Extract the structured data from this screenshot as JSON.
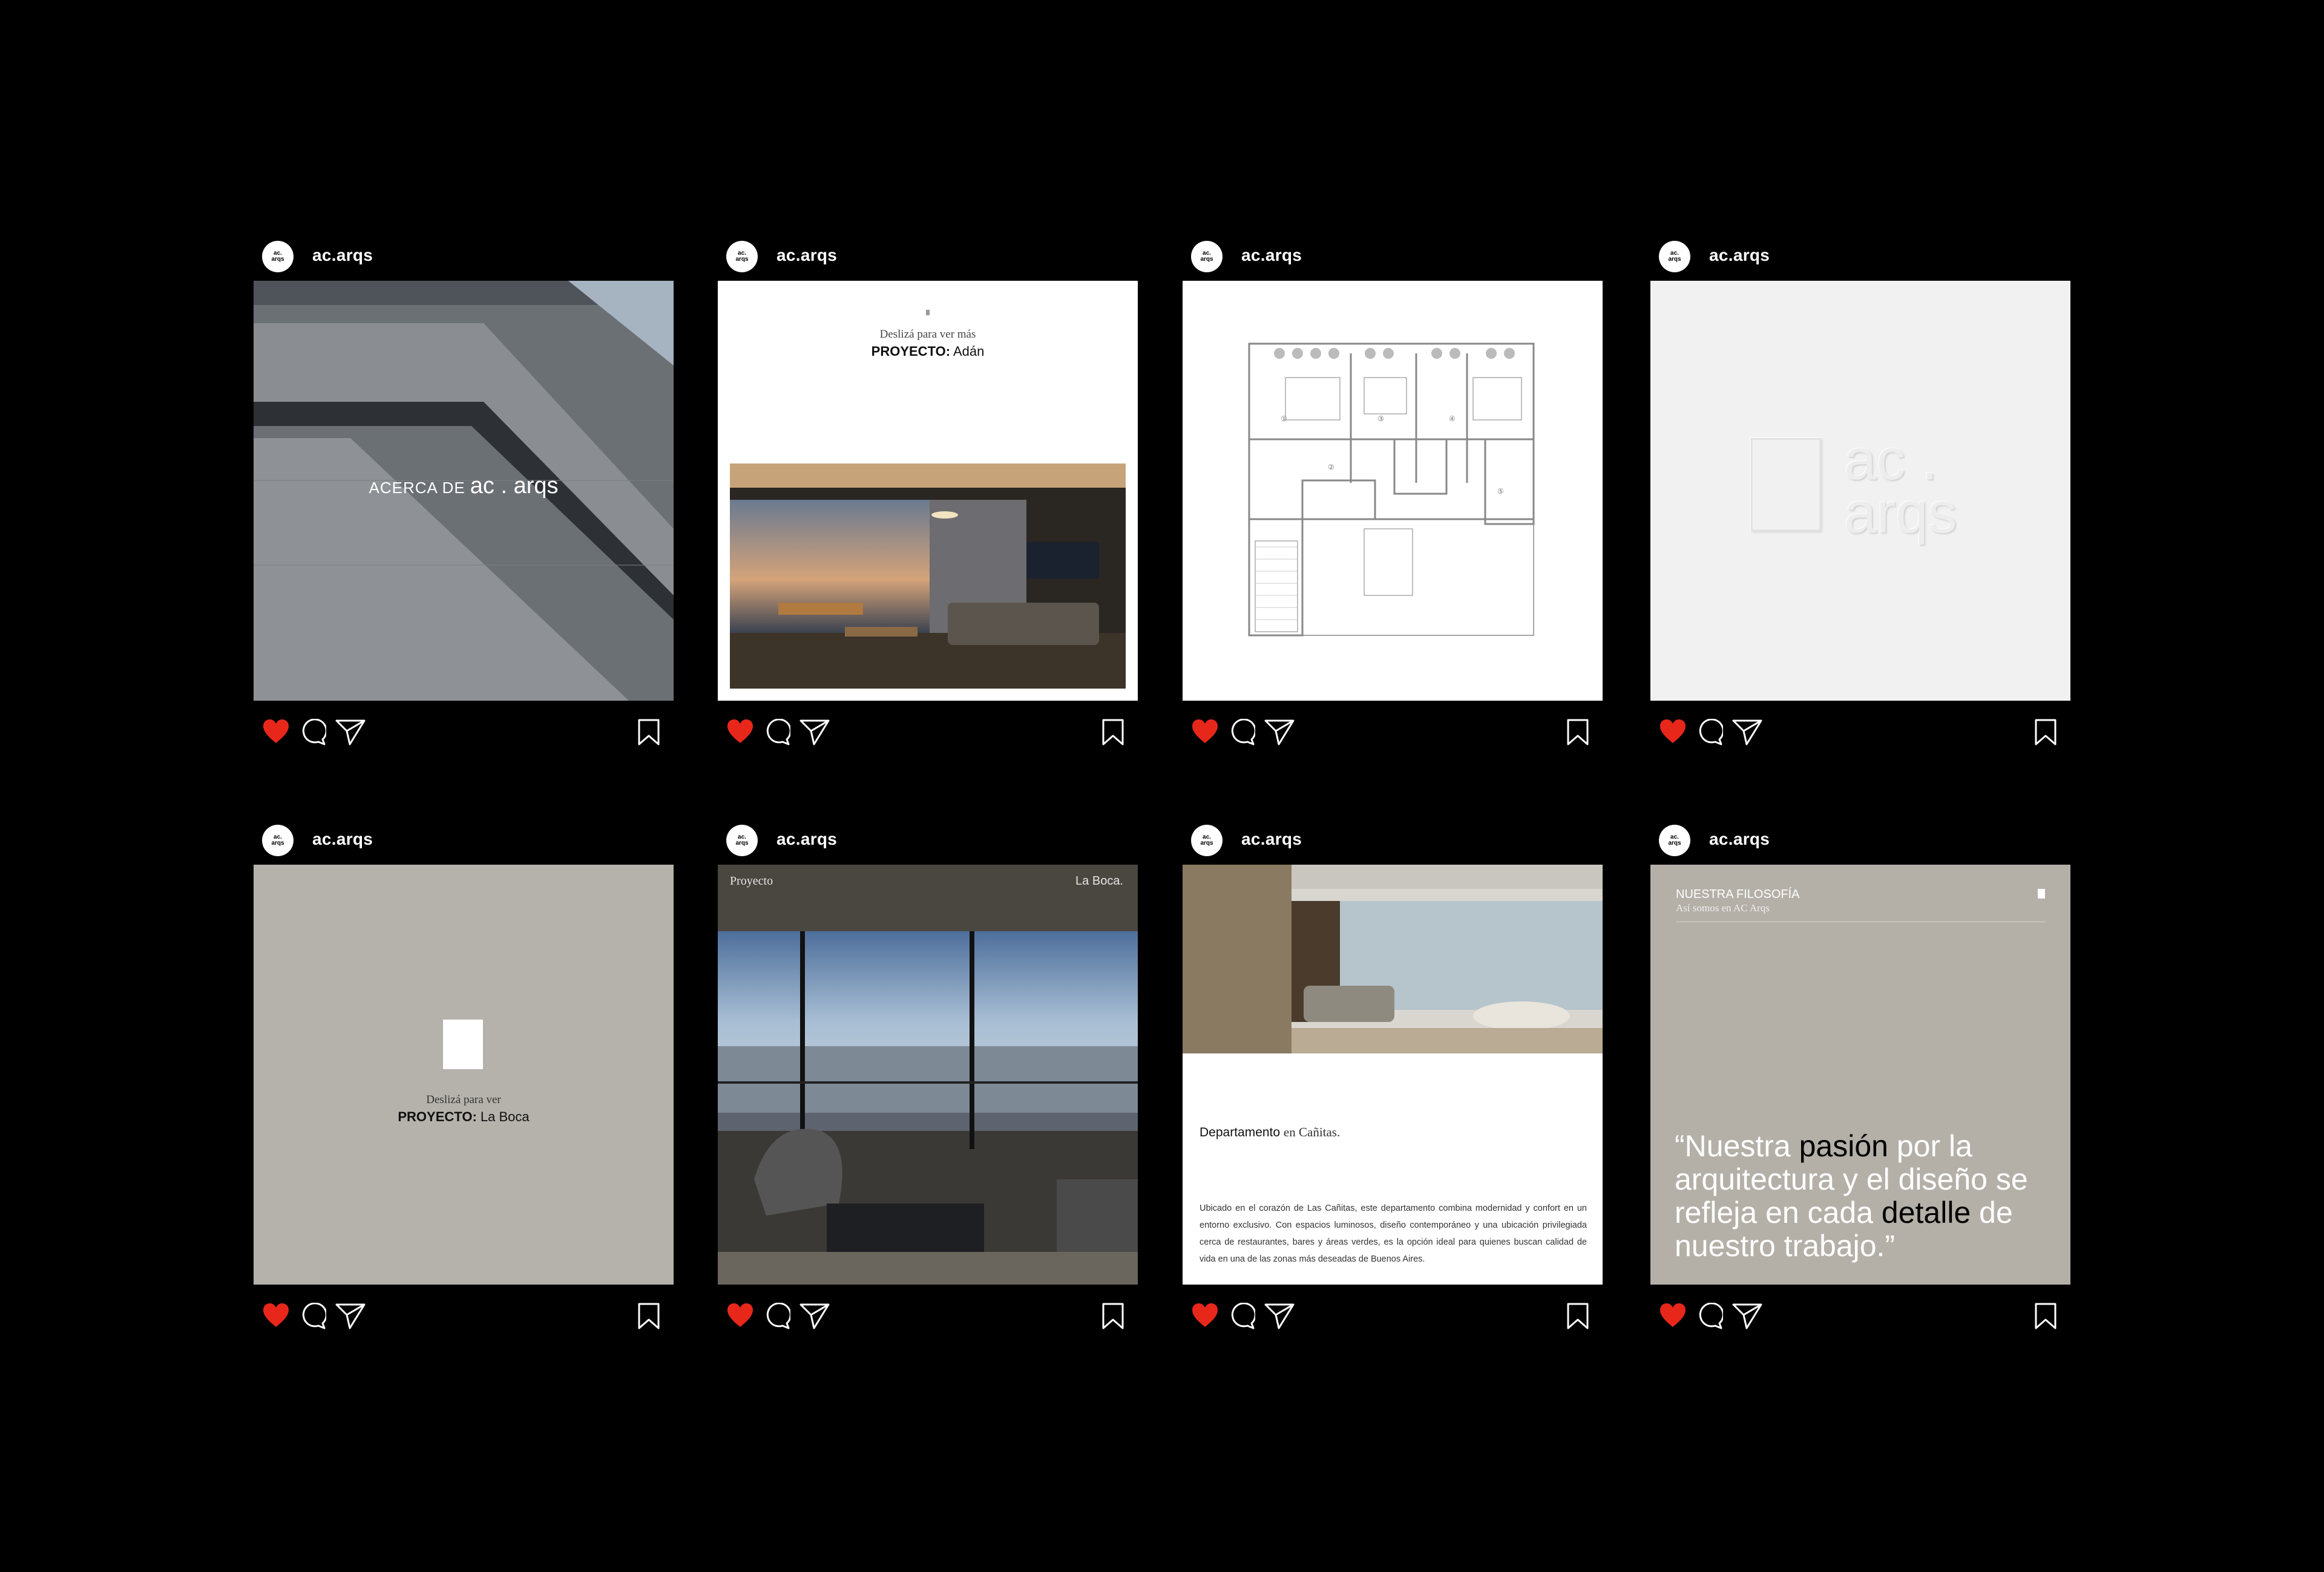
{
  "colors": {
    "background": "#000000",
    "like": "#e8271b",
    "grey_card": "#b5b2ab"
  },
  "icons": [
    "heart-icon",
    "comment-icon",
    "share-icon",
    "bookmark-icon"
  ],
  "avatar": {
    "line1": "ac.",
    "line2": "arqs"
  },
  "posts": [
    {
      "username": "ac.arqs",
      "media": {
        "prefix": "ACERCA DE",
        "brand": "ac . arqs"
      }
    },
    {
      "username": "ac.arqs",
      "media": {
        "hint": "Deslizá para ver más",
        "project_label": "PROYECTO:",
        "project_name": "Adán"
      }
    },
    {
      "username": "ac.arqs",
      "media": {
        "plan_numbers": [
          "①",
          "②",
          "③",
          "④",
          "⑤"
        ]
      }
    },
    {
      "username": "ac.arqs",
      "media": {
        "embossed_line1": "ac .",
        "embossed_line2": "arqs"
      }
    },
    {
      "username": "ac.arqs",
      "media": {
        "hint": "Deslizá para ver",
        "project_label": "PROYECTO:",
        "project_name": "La Boca"
      }
    },
    {
      "username": "ac.arqs",
      "media": {
        "left_label": "Proyecto",
        "right_label": "La Boca."
      }
    },
    {
      "username": "ac.arqs",
      "media": {
        "title": "Departamento",
        "title_rest": "en Cañitas.",
        "body": "Ubicado en el corazón de Las Cañitas, este departamento combina modernidad y confort en un entorno exclusivo. Con espacios luminosos, diseño contemporáneo y una ubicación privilegiada cerca de restaurantes, bares y áreas verdes, es la opción ideal para quienes buscan calidad de vida en una de las zonas más deseadas de Buenos Aires."
      }
    },
    {
      "username": "ac.arqs",
      "media": {
        "heading": "NUESTRA FILOSOFÍA",
        "subheading": "Así somos en AC Arqs",
        "q1": "“Nuestra ",
        "q2": "pasión",
        "q3": " por la arquitectura y el diseño se refleja en cada ",
        "q4": "detalle",
        "q5": " de nuestro trabajo.”"
      }
    }
  ]
}
